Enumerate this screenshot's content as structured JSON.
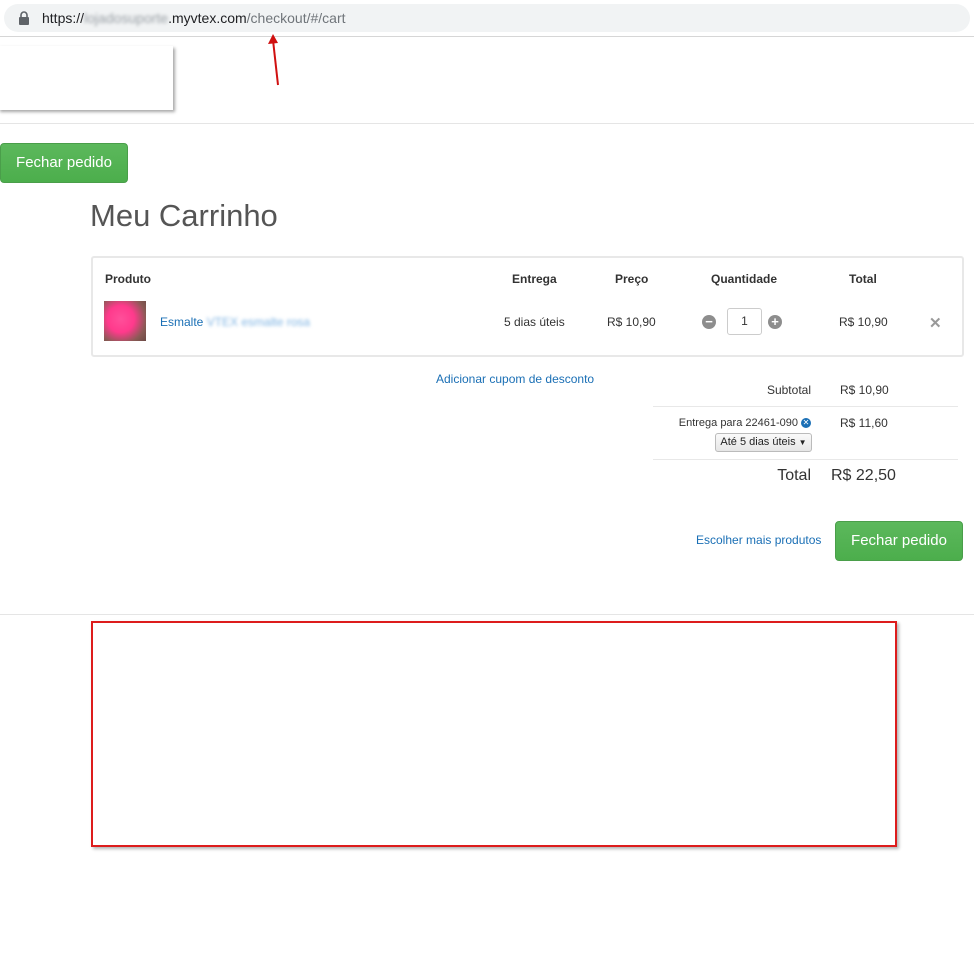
{
  "browser": {
    "url_prefix": "https://",
    "url_blurred": "lojadosuporte",
    "url_domain": ".myvtex.com",
    "url_path": "/checkout/#/cart"
  },
  "header": {
    "top_button_label": "Fechar pedido"
  },
  "page_title": "Meu Carrinho",
  "cart": {
    "columns": {
      "product": "Produto",
      "delivery": "Entrega",
      "price": "Preço",
      "quantity": "Quantidade",
      "total": "Total"
    },
    "items": [
      {
        "name_visible": "Esmalte",
        "name_blurred": "VTEX esmalte rosa",
        "delivery": "5 dias úteis",
        "price": "R$ 10,90",
        "quantity": "1",
        "total": "R$ 10,90",
        "thumb_color": "#ff3a8c"
      }
    ]
  },
  "coupon_link": "Adicionar cupom de desconto",
  "summary": {
    "subtotal_label": "Subtotal",
    "subtotal_value": "R$ 10,90",
    "shipping_label": "Entrega para 22461-090",
    "shipping_value": "R$ 11,60",
    "shipping_option": "Até 5 dias úteis",
    "total_label": "Total",
    "total_value": "R$ 22,50"
  },
  "actions": {
    "continue_link": "Escolher mais produtos",
    "checkout_button": "Fechar pedido"
  },
  "colors": {
    "primary_green": "#5cb85c",
    "link_blue": "#1a6fb5",
    "highlight_red": "#dd1c1c"
  }
}
